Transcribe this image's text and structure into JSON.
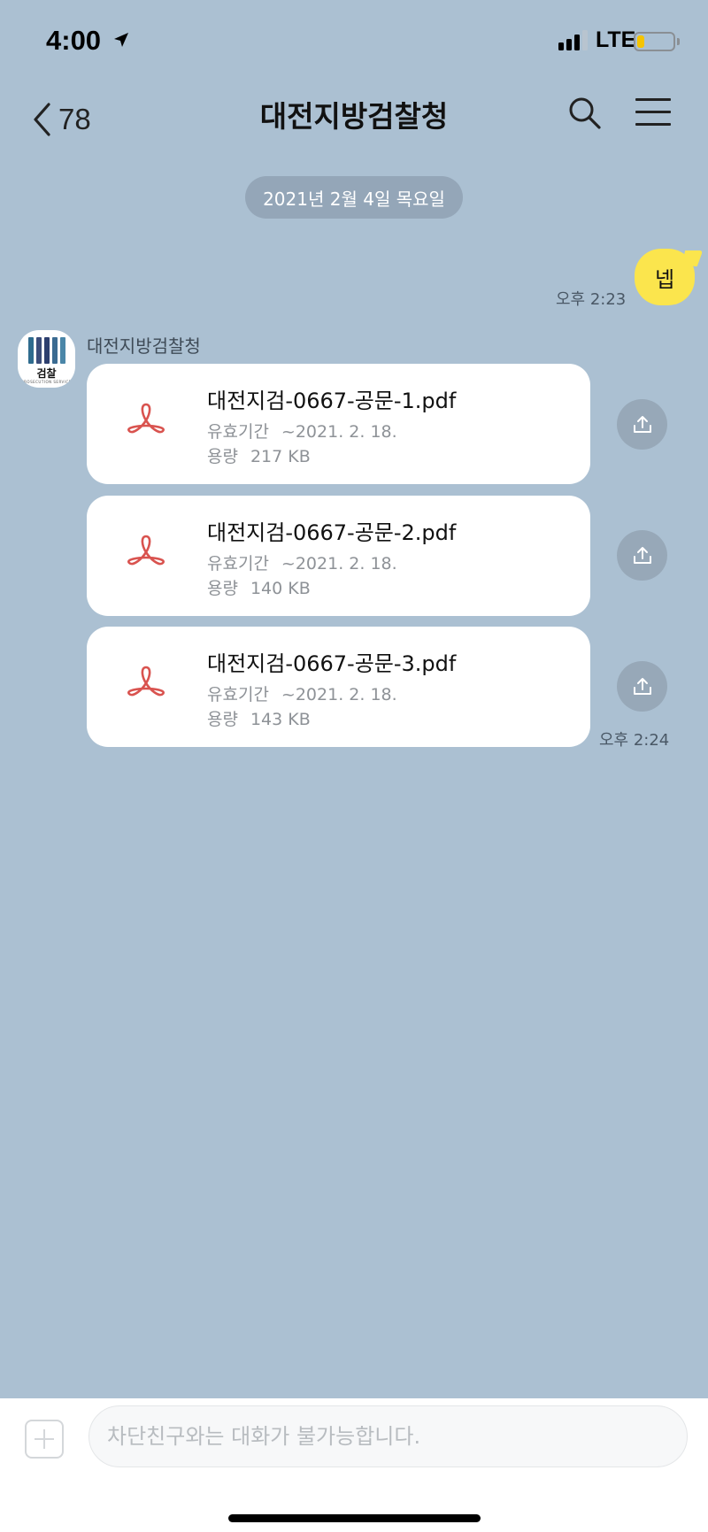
{
  "status_bar": {
    "time": "4:00",
    "network": "LTE",
    "battery_level": 0.2,
    "icons": [
      "location-arrow-icon",
      "signal-icon",
      "battery-icon"
    ]
  },
  "header": {
    "back_count": "78",
    "title": "대전지방검찰청",
    "icons": [
      "chevron-left-icon",
      "search-icon",
      "menu-icon"
    ]
  },
  "date_divider": "2021년 2월 4일 목요일",
  "my_message": {
    "text": "넵",
    "time": "오후 2:23"
  },
  "sender": {
    "name": "대전지방검찰청",
    "avatar_text": "검찰",
    "avatar_subtext": "PROSECUTION SERVICE",
    "avatar_bar_colors": [
      "#2f6c8e",
      "#3b4d7a",
      "#2d3f6e",
      "#3b6b91",
      "#4a86a8"
    ]
  },
  "files": [
    {
      "name": "대전지검-0667-공문-1.pdf",
      "expiry_label": "유효기간",
      "expiry": "~2021. 2. 18.",
      "size_label": "용량",
      "size": "217 KB"
    },
    {
      "name": "대전지검-0667-공문-2.pdf",
      "expiry_label": "유효기간",
      "expiry": "~2021. 2. 18.",
      "size_label": "용량",
      "size": "140 KB"
    },
    {
      "name": "대전지검-0667-공문-3.pdf",
      "expiry_label": "유효기간",
      "expiry": "~2021. 2. 18.",
      "size_label": "용량",
      "size": "143 KB"
    }
  ],
  "files_time": "오후 2:24",
  "input": {
    "placeholder": "차단친구와는 대화가 불가능합니다."
  },
  "colors": {
    "background": "#abc0d2",
    "my_bubble": "#fbe54d",
    "pdf_icon": "#d9534f",
    "share_button": "#97a8b8"
  }
}
